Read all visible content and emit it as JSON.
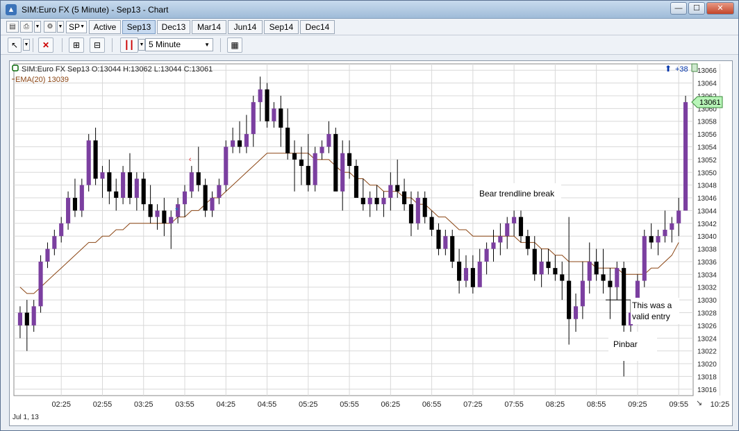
{
  "window": {
    "title": "SIM:Euro FX (5 Minute) - Sep13 - Chart",
    "minimize": "—",
    "maximize": "☐",
    "close": "✕"
  },
  "toolbar": {
    "instrument_box": "SP",
    "tabs": [
      "Active",
      "Sep13",
      "Dec13",
      "Mar14",
      "Jun14",
      "Sep14",
      "Dec14"
    ],
    "active_tab": "Sep13",
    "interval": "5 Minute"
  },
  "chart": {
    "header_instrument": "SIM:Euro FX Sep13 O:13044 H:13062 L:13044 C:13061",
    "indicator_label": "EMA(20)  13039",
    "date_label": "Jul 1, 13",
    "badge_count": "+38",
    "last_price": "13061",
    "colors": {
      "up": "#7b3fa0",
      "down": "#000000",
      "ema": "#8b4513",
      "grid": "#d8d8d8",
      "price_tag": "#b8f5b8"
    },
    "annotations": {
      "bear_break": "Bear trendline break",
      "valid_entry_1": "This was a",
      "valid_entry_2": "valid entry",
      "pinbar": "Pinbar"
    }
  },
  "chart_data": {
    "type": "candlestick",
    "y_ticks": [
      13016,
      13018,
      13020,
      13022,
      13024,
      13026,
      13028,
      13030,
      13032,
      13034,
      13036,
      13038,
      13040,
      13042,
      13044,
      13046,
      13048,
      13050,
      13052,
      13054,
      13056,
      13058,
      13060,
      13062,
      13064,
      13066
    ],
    "x_ticks": [
      "02:25",
      "02:55",
      "03:25",
      "03:55",
      "04:25",
      "04:55",
      "05:25",
      "05:55",
      "06:25",
      "06:55",
      "07:25",
      "07:55",
      "08:25",
      "08:55",
      "09:25",
      "09:55",
      "10:25"
    ],
    "ylim": [
      13015,
      13067
    ],
    "candles": [
      [
        13026,
        13029,
        13024,
        13028
      ],
      [
        13028,
        13030,
        13022,
        13026
      ],
      [
        13026,
        13030,
        13025,
        13029
      ],
      [
        13029,
        13037,
        13028,
        13036
      ],
      [
        13036,
        13039,
        13035,
        13038
      ],
      [
        13038,
        13041,
        13037,
        13040
      ],
      [
        13040,
        13043,
        13039,
        13042
      ],
      [
        13042,
        13047,
        13041,
        13046
      ],
      [
        13046,
        13049,
        13043,
        13044
      ],
      [
        13044,
        13049,
        13043,
        13048
      ],
      [
        13048,
        13056,
        13047,
        13055
      ],
      [
        13055,
        13057,
        13048,
        13049
      ],
      [
        13049,
        13051,
        13046,
        13050
      ],
      [
        13050,
        13052,
        13045,
        13047
      ],
      [
        13047,
        13049,
        13044,
        13046
      ],
      [
        13046,
        13051,
        13045,
        13050
      ],
      [
        13050,
        13053,
        13045,
        13046
      ],
      [
        13046,
        13050,
        13044,
        13049
      ],
      [
        13049,
        13050,
        13044,
        13045
      ],
      [
        13045,
        13048,
        13042,
        13043
      ],
      [
        13043,
        13045,
        13041,
        13044
      ],
      [
        13044,
        13046,
        13040,
        13042
      ],
      [
        13042,
        13044,
        13038,
        13043
      ],
      [
        13043,
        13046,
        13042,
        13045
      ],
      [
        13045,
        13048,
        13043,
        13047
      ],
      [
        13047,
        13051,
        13046,
        13050
      ],
      [
        13050,
        13054,
        13047,
        13048
      ],
      [
        13048,
        13049,
        13043,
        13044
      ],
      [
        13044,
        13047,
        13043,
        13046
      ],
      [
        13046,
        13049,
        13045,
        13048
      ],
      [
        13048,
        13055,
        13047,
        13054
      ],
      [
        13054,
        13057,
        13053,
        13055
      ],
      [
        13055,
        13058,
        13053,
        13054
      ],
      [
        13054,
        13059,
        13053,
        13056
      ],
      [
        13056,
        13062,
        13054,
        13061
      ],
      [
        13061,
        13065,
        13058,
        13063
      ],
      [
        13063,
        13064,
        13057,
        13058
      ],
      [
        13058,
        13061,
        13057,
        13060
      ],
      [
        13060,
        13062,
        13054,
        13057
      ],
      [
        13057,
        13060,
        13052,
        13053
      ],
      [
        13053,
        13055,
        13047,
        13052
      ],
      [
        13052,
        13054,
        13048,
        13051
      ],
      [
        13051,
        13056,
        13047,
        13048
      ],
      [
        13048,
        13054,
        13047,
        13053
      ],
      [
        13053,
        13055,
        13052,
        13054
      ],
      [
        13054,
        13058,
        13053,
        13056
      ],
      [
        13056,
        13057,
        13048,
        13047
      ],
      [
        13047,
        13055,
        13044,
        13053
      ],
      [
        13053,
        13055,
        13049,
        13051
      ],
      [
        13051,
        13052,
        13046,
        13046
      ],
      [
        13046,
        13049,
        13044,
        13045
      ],
      [
        13045,
        13047,
        13043,
        13046
      ],
      [
        13046,
        13048,
        13044,
        13045
      ],
      [
        13045,
        13047,
        13043,
        13046
      ],
      [
        13046,
        13050,
        13044,
        13048
      ],
      [
        13048,
        13052,
        13046,
        13047
      ],
      [
        13047,
        13049,
        13044,
        13045
      ],
      [
        13045,
        13047,
        13040,
        13042
      ],
      [
        13042,
        13047,
        13041,
        13046
      ],
      [
        13046,
        13047,
        13042,
        13043
      ],
      [
        13043,
        13044,
        13040,
        13041
      ],
      [
        13041,
        13042,
        13037,
        13038
      ],
      [
        13038,
        13041,
        13037,
        13040
      ],
      [
        13040,
        13041,
        13035,
        13036
      ],
      [
        13036,
        13038,
        13031,
        13033
      ],
      [
        13033,
        13037,
        13032,
        13035
      ],
      [
        13035,
        13037,
        13031,
        13032
      ],
      [
        13032,
        13038,
        13032,
        13036
      ],
      [
        13036,
        13039,
        13034,
        13038
      ],
      [
        13038,
        13041,
        13036,
        13039
      ],
      [
        13039,
        13042,
        13037,
        13040
      ],
      [
        13040,
        13043,
        13038,
        13042
      ],
      [
        13042,
        13044,
        13040,
        13043
      ],
      [
        13043,
        13044,
        13039,
        13040
      ],
      [
        13040,
        13041,
        13037,
        13038
      ],
      [
        13038,
        13040,
        13033,
        13034
      ],
      [
        13034,
        13038,
        13032,
        13036
      ],
      [
        13036,
        13038,
        13034,
        13035
      ],
      [
        13035,
        13037,
        13033,
        13034
      ],
      [
        13034,
        13036,
        13030,
        13033
      ],
      [
        13033,
        13043,
        13023,
        13027
      ],
      [
        13027,
        13031,
        13025,
        13029
      ],
      [
        13029,
        13036,
        13027,
        13033
      ],
      [
        13033,
        13039,
        13031,
        13036
      ],
      [
        13036,
        13038,
        13033,
        13034
      ],
      [
        13034,
        13038,
        13031,
        13033
      ],
      [
        13033,
        13035,
        13027,
        13032
      ],
      [
        13032,
        13036,
        13030,
        13035
      ],
      [
        13035,
        13036,
        13018,
        13026
      ],
      [
        13026,
        13030,
        13025,
        13028
      ],
      [
        13028,
        13034,
        13027,
        13033
      ],
      [
        13033,
        13041,
        13032,
        13040
      ],
      [
        13040,
        13042,
        13038,
        13039
      ],
      [
        13039,
        13041,
        13037,
        13040
      ],
      [
        13040,
        13044,
        13039,
        13041
      ],
      [
        13041,
        13043,
        13039,
        13042
      ],
      [
        13042,
        13046,
        13040,
        13044
      ],
      [
        13044,
        13062,
        13044,
        13061
      ]
    ],
    "ema": [
      13032,
      13031,
      13031,
      13032,
      13033,
      13034,
      13035,
      13036,
      13037,
      13038,
      13039,
      13039,
      13040,
      13040,
      13041,
      13041,
      13042,
      13042,
      13042,
      13042,
      13042,
      13042,
      13042,
      13043,
      13043,
      13044,
      13044,
      13045,
      13046,
      13046,
      13047,
      13048,
      13049,
      13050,
      13051,
      13052,
      13053,
      13053,
      13053,
      13053,
      13053,
      13053,
      13053,
      13052,
      13052,
      13052,
      13051,
      13050,
      13050,
      13049,
      13049,
      13048,
      13048,
      13047,
      13047,
      13047,
      13046,
      13046,
      13045,
      13045,
      13044,
      13043,
      13043,
      13042,
      13041,
      13041,
      13040,
      13040,
      13040,
      13040,
      13040,
      13040,
      13040,
      13039,
      13039,
      13039,
      13038,
      13038,
      13037,
      13037,
      13036,
      13036,
      13036,
      13036,
      13035,
      13035,
      13035,
      13035,
      13034,
      13034,
      13034,
      13034,
      13035,
      13035,
      13036,
      13037,
      13039
    ]
  }
}
